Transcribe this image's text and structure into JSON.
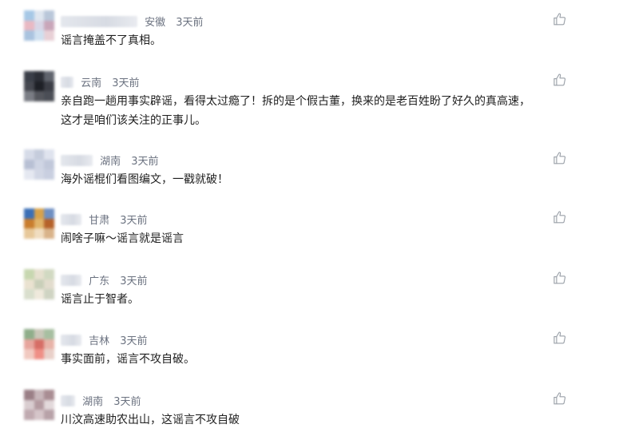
{
  "comments": [
    {
      "location": "安徽",
      "time": "3天前",
      "text": "谣言掩盖不了真相。",
      "avatar": [
        "#a6c8e6",
        "#dfe6ef",
        "#b9c7d9",
        "#e9b9c3",
        "#d8d6e6",
        "#c9a6b9",
        "#a9c3df",
        "#cfe0f0",
        "#e8d0d6"
      ]
    },
    {
      "location": "云南",
      "time": "3天前",
      "text": "亲自跑一趟用事实辟谣，看得太过瘾了！拆的是个假古董，换来的是老百姓盼了好久的真高速，\n这才是咱们该关注的正事儿。",
      "avatar": [
        "#3a3e48",
        "#2c2f37",
        "#60646d",
        "#45474f",
        "#1e2026",
        "#3b3d45",
        "#7a7d84",
        "#55575e",
        "#4b4e56"
      ]
    },
    {
      "location": "湖南",
      "time": "3天前",
      "text": "海外谣棍们看图编文，一戳就破！",
      "avatar": [
        "#d6dbe8",
        "#c5ccdc",
        "#dfe3ee",
        "#b8c0d4",
        "#cfd5e4",
        "#c1c8da",
        "#e5e8f1",
        "#d2d7e5",
        "#c9cfe0"
      ]
    },
    {
      "location": "甘肃",
      "time": "3天前",
      "text": "闹啥子嘛～谣言就是谣言",
      "avatar": [
        "#3b6fb6",
        "#d8a24a",
        "#6e8fc2",
        "#c97d2e",
        "#e0b36a",
        "#b5622a",
        "#e7c89a",
        "#f0ddc0",
        "#d9b38a"
      ]
    },
    {
      "location": "广东",
      "time": "3天前",
      "text": "谣言止于智者。",
      "avatar": [
        "#c7d7b0",
        "#e6e0cf",
        "#d1d9c2",
        "#eae2d0",
        "#c9cfb9",
        "#e2dccd",
        "#d9dfcd",
        "#efe9dc",
        "#cfd4c3"
      ]
    },
    {
      "location": "吉林",
      "time": "3天前",
      "text": "事实面前，谣言不攻自破。",
      "avatar": [
        "#8fae8a",
        "#c9c7b8",
        "#a7bfa1",
        "#e7a59d",
        "#d66e66",
        "#e8b3a8",
        "#f1c9c0",
        "#ef8f86",
        "#e9d0c9"
      ]
    },
    {
      "location": "湖南",
      "time": "3天前",
      "text": "川汶高速助农出山，这谣言不攻自破",
      "avatar": [
        "#9a7f86",
        "#c7b6ba",
        "#a98d93",
        "#d9cdd0",
        "#b49ba1",
        "#e3d9db",
        "#c0aab0",
        "#d5c5c9",
        "#b8a2a8"
      ]
    }
  ]
}
